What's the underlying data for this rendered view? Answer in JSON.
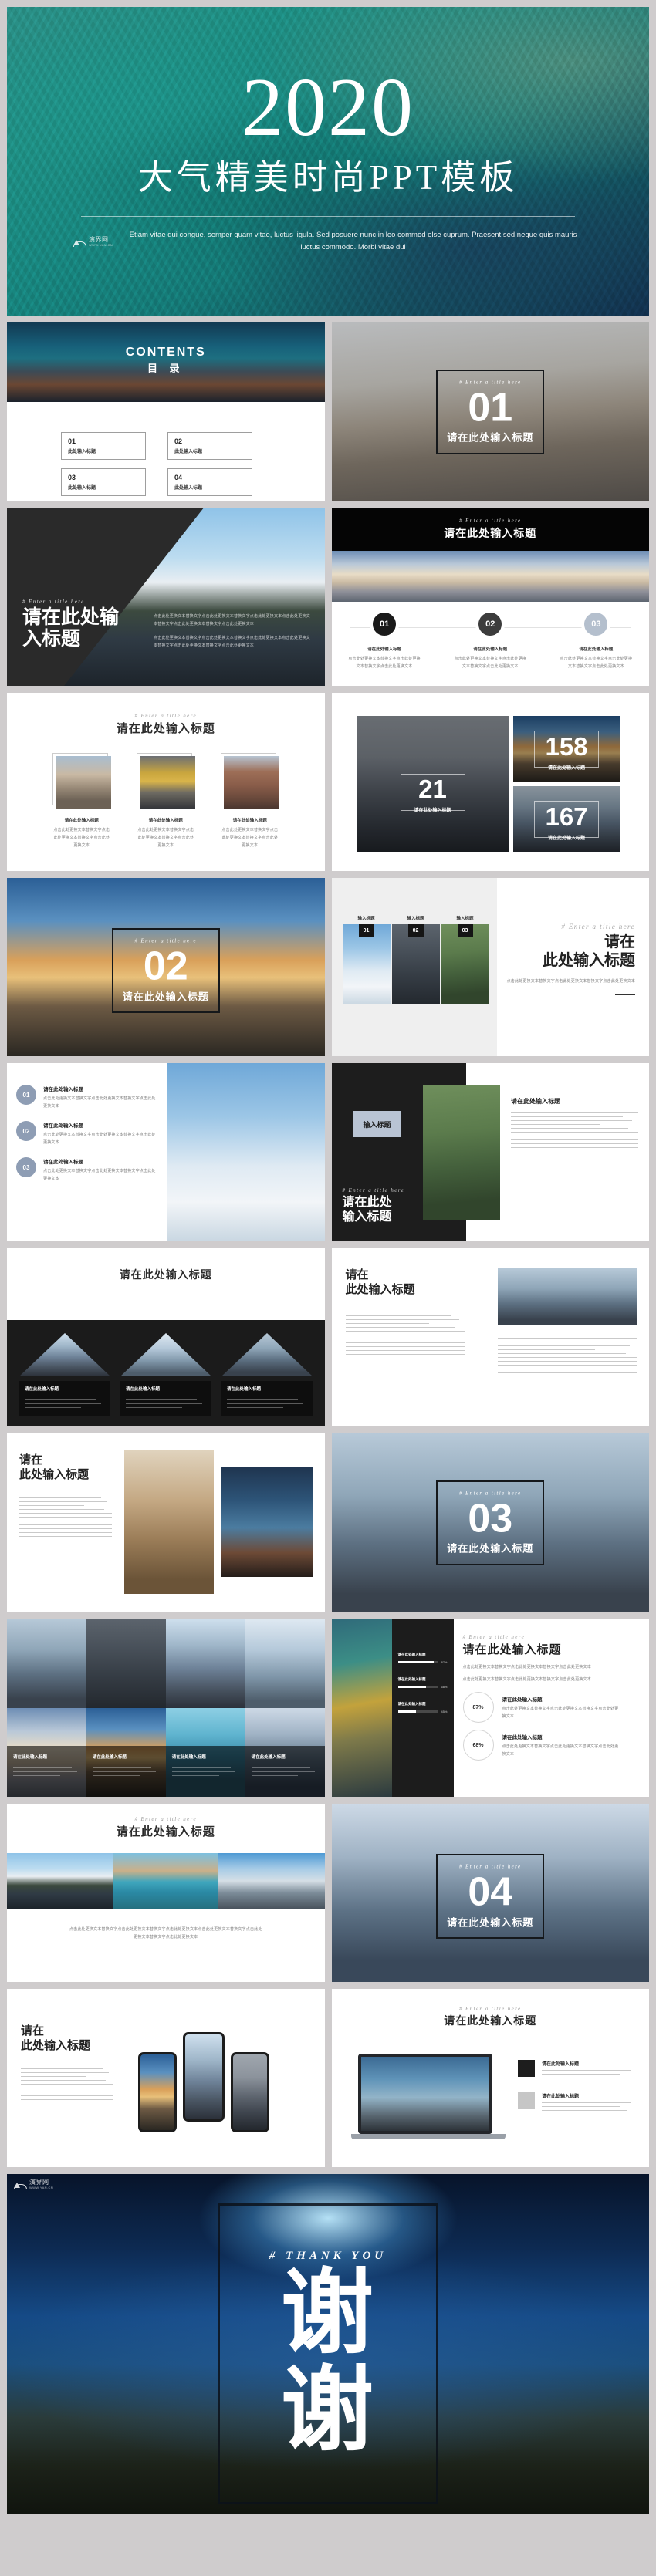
{
  "cover": {
    "year": "2020",
    "title": "大气精美时尚PPT模板",
    "desc": "Etiam vitae dui congue, semper quam vitae, luctus ligula. Sed posuere nunc in leo commod else cuprum. Praesent sed neque quis mauris luctus commodo. Morbi vitae dui",
    "watermark_name": "演界网",
    "watermark_url": "WWW.YAN.CN"
  },
  "common": {
    "kicker": "# Enter a title here",
    "title_cn": "请在此处输入标题",
    "title_cn_short": "此处输入标题",
    "title_cn_input": "输入标题",
    "body_cn": "点击此处更换文本替换文字点击此处更换文本替换文字点击此处更换文本点击此处更换文本替换文字点击此处更换文本替换文字点击此处更换文本",
    "body_cn_short": "点击此处更换文本替换文字点击此处更换文本替换文字点击此处更换文本"
  },
  "contents": {
    "heading_en": "CONTENTS",
    "heading_cn": "目  录",
    "items": [
      {
        "num": "01",
        "label": "此处输入标题"
      },
      {
        "num": "02",
        "label": "此处输入标题"
      },
      {
        "num": "03",
        "label": "此处输入标题"
      },
      {
        "num": "04",
        "label": "此处输入标题"
      }
    ]
  },
  "sections": [
    {
      "num": "01",
      "kicker": "# Enter a title here",
      "title": "请在此处输入标题"
    },
    {
      "num": "02",
      "kicker": "# Enter a title here",
      "title": "请在此处输入标题"
    },
    {
      "num": "03",
      "kicker": "# Enter a title here",
      "title": "请在此处输入标题"
    },
    {
      "num": "04",
      "kicker": "# Enter a title here",
      "title": "请在此处输入标题"
    }
  ],
  "slide_split_left": {
    "kicker": "# Enter a title here",
    "title_line1": "请在此处输",
    "title_line2": "入标题"
  },
  "slide_steps": {
    "kicker": "# Enter a title here",
    "title": "请在此处输入标题",
    "steps": [
      {
        "num": "01",
        "label": "请在此处输入标题"
      },
      {
        "num": "02",
        "label": "请在此处输入标题"
      },
      {
        "num": "03",
        "label": "请在此处输入标题"
      }
    ]
  },
  "slide_photos3": {
    "kicker": "# Enter a title here",
    "title": "请在此处输入标题",
    "captions": [
      "请在此处输入标题",
      "请在此处输入标题",
      "请在此处输入标题"
    ]
  },
  "slide_stats": {
    "cards": [
      {
        "value": "158",
        "label": "请在此处输入标题"
      },
      {
        "value": "21",
        "label": "请在此处输入标题"
      },
      {
        "value": "167",
        "label": "请在此处输入标题"
      },
      {
        "value": "",
        "label": ""
      }
    ]
  },
  "slide_cards3": {
    "kicker": "# Enter a title here",
    "title_line1": "请在",
    "title_line2": "此处输入标题",
    "captions": [
      "输入标题",
      "输入标题",
      "输入标题"
    ],
    "nums": [
      "01",
      "02",
      "03"
    ]
  },
  "slide_numlist": {
    "items": [
      {
        "num": "01",
        "title": "请在此处输入标题"
      },
      {
        "num": "02",
        "title": "请在此处输入标题"
      },
      {
        "num": "03",
        "title": "请在此处输入标题"
      }
    ]
  },
  "slide_dark_photo": {
    "tag": "输入标题",
    "kicker": "# Enter a title here",
    "title_line1": "请在此处",
    "title_line2": "输入标题",
    "right_title": "请在此处输入标题"
  },
  "slide_triangles": {
    "title": "请在此处输入标题",
    "items": [
      {
        "title": "请在此处输入标题"
      },
      {
        "title": "请在此处输入标题"
      },
      {
        "title": "请在此处输入标题"
      }
    ]
  },
  "slide_two_col": {
    "title_line1": "请在",
    "title_line2": "此处输入标题"
  },
  "slide_mosaic": {
    "captions": [
      "请在此处输入标题",
      "请在此处输入标题",
      "请在此处输入标题",
      "请在此处输入标题"
    ]
  },
  "slide_percent": {
    "kicker": "# Enter a title here",
    "title": "请在此处输入标题",
    "bars": [
      {
        "label": "请在此处输入标题",
        "value": "87%",
        "pct": 87
      },
      {
        "label": "请在此处输入标题",
        "value": "68%",
        "pct": 68
      },
      {
        "label": "请在此处输入标题",
        "value": "45%",
        "pct": 45
      }
    ],
    "circles": [
      {
        "value": "87%",
        "title": "请在此处输入标题"
      },
      {
        "value": "68%",
        "title": "请在此处输入标题"
      }
    ]
  },
  "slide_gallery3": {
    "kicker": "# Enter a title here",
    "title": "请在此处输入标题"
  },
  "slide_phones": {
    "title_line1": "请在",
    "title_line2": "此处输入标题"
  },
  "slide_laptop": {
    "kicker": "# Enter a title here",
    "title": "请在此处输入标题",
    "items": [
      {
        "title": "请在此处输入标题"
      },
      {
        "title": "请在此处输入标题"
      }
    ]
  },
  "thanks": {
    "kicker": "# THANK YOU",
    "line1": "谢",
    "line2": "谢",
    "watermark_name": "演界网",
    "watermark_url": "WWW.YAN.CN"
  },
  "colors": {
    "dark": "#1d1d1d",
    "mid": "#3a3a3a",
    "steel": "#aeb9c9",
    "page_bg": "#cfcccd"
  }
}
